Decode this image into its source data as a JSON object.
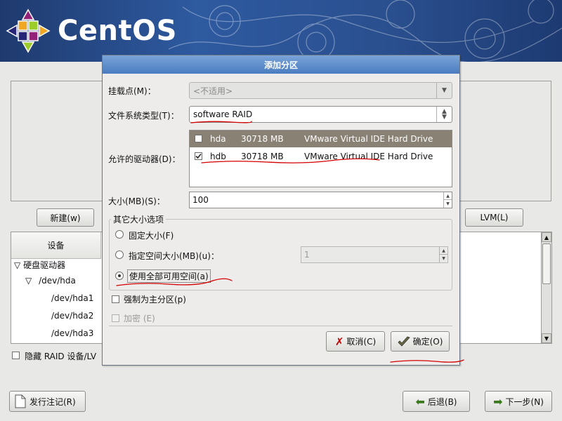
{
  "brand": {
    "name": "CentOS"
  },
  "background": {
    "new_button": "新建(w)",
    "lvm_button": "LVM(L)",
    "tree": {
      "header_device": "设备",
      "rows": [
        "硬盘驱动器",
        "/dev/hda",
        "/dev/hda1",
        "/dev/hda2",
        "/dev/hda3"
      ]
    },
    "hide_raid_label": "隐藏 RAID 设备/LV",
    "release_notes_button": "发行注记(R)",
    "back_button": "后退(B)",
    "next_button": "下一步(N)"
  },
  "dialog": {
    "title": "添加分区",
    "mount_point": {
      "label": "挂载点(M)：",
      "value": "<不适用>"
    },
    "fs_type": {
      "label": "文件系统类型(T)：",
      "value": "software RAID"
    },
    "drives": {
      "label": "允许的驱动器(D)：",
      "rows": [
        {
          "checked": false,
          "name": "hda",
          "size": "30718 MB",
          "model": "VMware Virtual IDE Hard Drive"
        },
        {
          "checked": true,
          "name": "hdb",
          "size": "30718 MB",
          "model": "VMware Virtual IDE Hard Drive"
        }
      ]
    },
    "size": {
      "label": "大小(MB)(S)：",
      "value": "100"
    },
    "other_size_options": {
      "label": "其它大小选项",
      "fixed_size": "固定大小(F)",
      "fill_up_to": "指定空间大小(MB)(u)：",
      "fill_up_to_value": "1",
      "fill_all": "使用全部可用空间(a)",
      "selected": "fill_all"
    },
    "force_primary": {
      "label": "强制为主分区(p)",
      "checked": false
    },
    "encrypt": {
      "label": "加密 (E)",
      "checked": false,
      "disabled": true
    },
    "cancel_button": "取消(C)",
    "ok_button": "确定(O)"
  },
  "colors": {
    "banner": "#2e5aa0",
    "dialog_title_bar": "#4a7cc0",
    "selected_row": "#8a8175",
    "annotation_red": "#d40000"
  }
}
